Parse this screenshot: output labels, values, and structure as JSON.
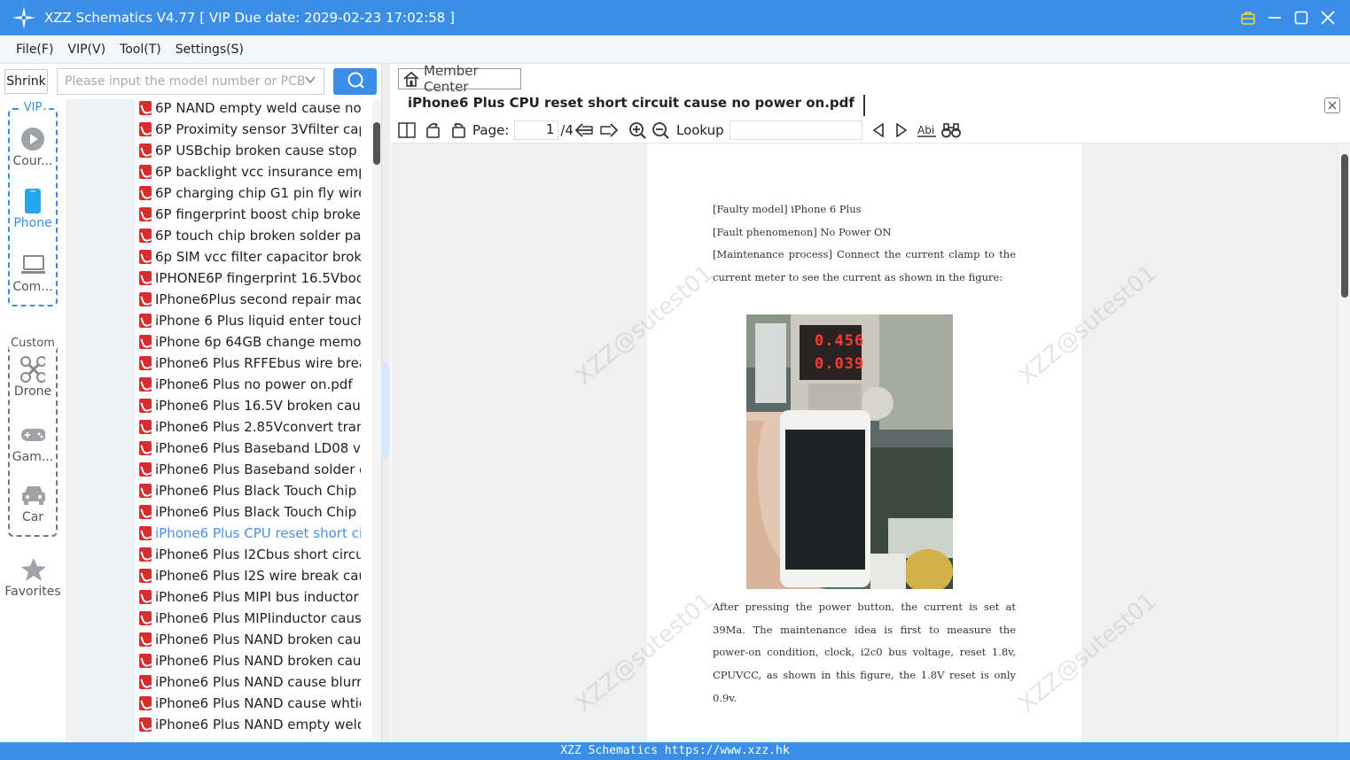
{
  "window": {
    "title": "XZZ Schematics V4.77 [ VIP Due date: 2029-02-23 17:02:58 ]"
  },
  "menu": [
    "File(F)",
    "VIP(V)",
    "Tool(T)",
    "Settings(S)"
  ],
  "sidebar": {
    "shrink_label": "Shrink",
    "vip_group_label": "VIP",
    "custom_group_label": "Custom",
    "items": [
      {
        "label": "Cour...",
        "icon": "play-icon"
      },
      {
        "label": "Phone",
        "icon": "phone-icon"
      },
      {
        "label": "Com...",
        "icon": "laptop-icon"
      },
      {
        "label": "Drone",
        "icon": "drone-icon"
      },
      {
        "label": "Gam...",
        "icon": "gamepad-icon"
      },
      {
        "label": "Car",
        "icon": "car-icon"
      },
      {
        "label": "Favorites",
        "icon": "star-icon"
      }
    ]
  },
  "search": {
    "placeholder": "Please input the model number or PCB"
  },
  "files": [
    "6P NAND empty weld cause no po",
    "6P Proximity sensor 3Vfilter capaci",
    "6P USBchip broken cause stop at 2",
    "6P backlight vcc insurance empty v",
    "6P charging chip G1 pin fly wire re",
    "6P fingerprint boost chip broken c",
    "6P touch chip broken solder pad s",
    "6p SIM vcc filter capacitor broken c",
    "IPHONE6P fingerprint 16.5Vboost c",
    "IPhone6Plus second repair machin",
    "iPhone 6 Plus liquid enter touch cc",
    "iPhone 6p 64GB change memory F",
    "iPhone6 Plus  RFFEbus wire break",
    "iPhone6 Plus  no power on.pdf",
    "iPhone6 Plus 16.5V broken cause r",
    "iPhone6 Plus 2.85Vconvert transist",
    "iPhone6 Plus Baseband LD08 vcc s",
    "iPhone6 Plus Baseband solder dot",
    "iPhone6 Plus Black Touch Chip -5.",
    "iPhone6 Plus Black Touch Chip em",
    "iPhone6 Plus CPU reset short circu",
    "iPhone6 Plus I2Cbus short circuit c",
    "iPhone6 Plus I2S wire break  cause",
    "iPhone6 Plus MIPI bus inductor ca",
    "iPhone6 Plus MIPIinductor cause n",
    "iPhone6 Plus NAND broken cause",
    "iPhone6 Plus NAND broken cause",
    "iPhone6 Plus NAND cause blurred",
    "iPhone6 Plus NAND cause whtie a",
    "iPhone6 Plus NAND empty weld ca"
  ],
  "selected_file_index": 20,
  "right": {
    "member_center": "Member Center",
    "doc_title": "iPhone6 Plus CPU reset short circuit cause no power on.pdf",
    "page_label": "Page:",
    "page_current": "1",
    "page_total": "/4",
    "lookup_label": "Lookup"
  },
  "pdf": {
    "para1": [
      "[Faulty model] iPhone 6 Plus",
      "[Fault phenomenon] No Power ON",
      "[Maintenance process] Connect the current clamp to the current meter to see the current as shown in the figure:"
    ],
    "meter_top": "0.456",
    "meter_bottom": "0.039",
    "para2": "After pressing the power button, the current is set at 39Ma. The maintenance idea is first to measure the power-on condition, clock, i2c0 bus voltage, reset 1.8v, CPUVCC, as shown in this figure, the 1.8V reset is only 0.9v.",
    "watermark": "XZZ@sutest01"
  },
  "status": "XZZ Schematics https://www.xzz.hk",
  "colors": {
    "accent": "#3a8ee6",
    "pdf_icon": "#d32f2f",
    "selected_text": "#4a90e2"
  }
}
